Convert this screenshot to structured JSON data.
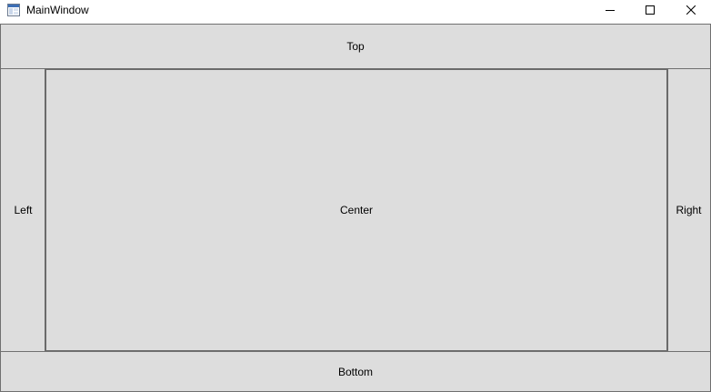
{
  "window": {
    "title": "MainWindow",
    "app_icon": "wpf-window-icon",
    "caption_buttons": {
      "minimize_icon": "minimize-icon",
      "maximize_icon": "maximize-icon",
      "close_icon": "close-icon"
    }
  },
  "dock_panel": {
    "top_label": "Top",
    "left_label": "Left",
    "center_label": "Center",
    "right_label": "Right",
    "bottom_label": "Bottom"
  },
  "colors": {
    "button_background": "#dddddd",
    "button_border": "#707070",
    "titlebar_background": "#ffffff"
  }
}
